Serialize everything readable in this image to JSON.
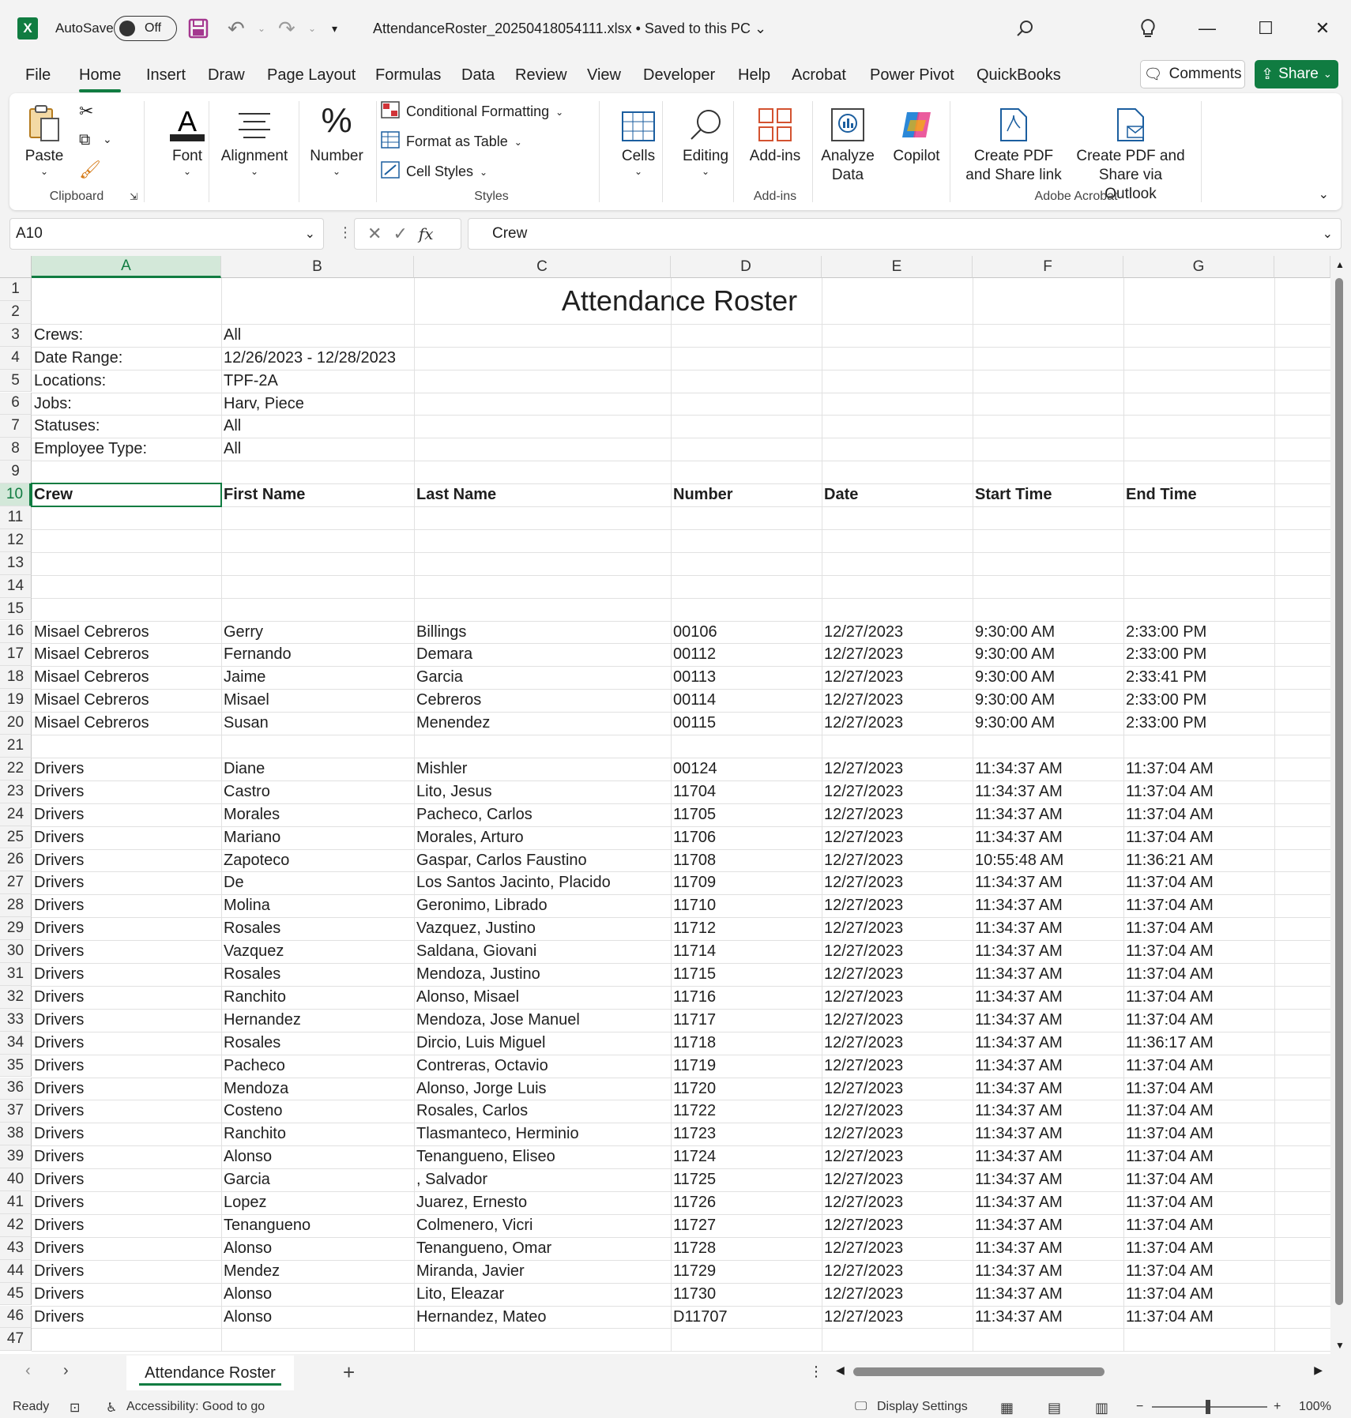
{
  "titlebar": {
    "autosave_label": "AutoSave",
    "autosave_state": "Off",
    "filename": "AttendanceRoster_20250418054111.xlsx • Saved to this PC"
  },
  "menu": [
    "File",
    "Home",
    "Insert",
    "Draw",
    "Page Layout",
    "Formulas",
    "Data",
    "Review",
    "View",
    "Developer",
    "Help",
    "Acrobat",
    "Power Pivot",
    "QuickBooks"
  ],
  "menu_active": "Home",
  "actions": {
    "comments": "Comments",
    "share": "Share"
  },
  "ribbon": {
    "paste": "Paste",
    "clipboard": "Clipboard",
    "font": "Font",
    "alignment": "Alignment",
    "number": "Number",
    "conditional_formatting": "Conditional Formatting",
    "format_as_table": "Format as Table",
    "cell_styles": "Cell Styles",
    "styles": "Styles",
    "cells": "Cells",
    "editing": "Editing",
    "addins": "Add-ins",
    "addins_group": "Add-ins",
    "analyze_data_1": "Analyze",
    "analyze_data_2": "Data",
    "copilot": "Copilot",
    "create_pdf_share_1": "Create PDF",
    "create_pdf_share_2": "and Share link",
    "create_pdf_outlook_1": "Create PDF and",
    "create_pdf_outlook_2": "Share via Outlook",
    "adobe_acrobat": "Adobe Acrobat"
  },
  "formula_bar": {
    "name_box": "A10",
    "value": "Crew"
  },
  "columns": [
    "A",
    "B",
    "C",
    "D",
    "E",
    "F",
    "G"
  ],
  "sheet": {
    "title": "Attendance Roster",
    "filters": [
      {
        "label": "Crews:",
        "value": "All"
      },
      {
        "label": "Date Range:",
        "value": "12/26/2023 - 12/28/2023"
      },
      {
        "label": "Locations:",
        "value": "TPF-2A"
      },
      {
        "label": "Jobs:",
        "value": "Harv, Piece"
      },
      {
        "label": "Statuses:",
        "value": "All"
      },
      {
        "label": "Employee Type:",
        "value": "All"
      }
    ],
    "headers": [
      "Crew",
      "First Name",
      "Last Name",
      "Number",
      "Date",
      "Start Time",
      "End Time"
    ],
    "rows": [
      {
        "r": 16,
        "v": [
          "Misael Cebreros",
          "Gerry",
          "Billings",
          "00106",
          "12/27/2023",
          "9:30:00 AM",
          "2:33:00 PM"
        ]
      },
      {
        "r": 17,
        "v": [
          "Misael Cebreros",
          "Fernando",
          "Demara",
          "00112",
          "12/27/2023",
          "9:30:00 AM",
          "2:33:00 PM"
        ]
      },
      {
        "r": 18,
        "v": [
          "Misael Cebreros",
          "Jaime",
          "Garcia",
          "00113",
          "12/27/2023",
          "9:30:00 AM",
          "2:33:41 PM"
        ]
      },
      {
        "r": 19,
        "v": [
          "Misael Cebreros",
          "Misael",
          "Cebreros",
          "00114",
          "12/27/2023",
          "9:30:00 AM",
          "2:33:00 PM"
        ]
      },
      {
        "r": 20,
        "v": [
          "Misael Cebreros",
          "Susan",
          "Menendez",
          "00115",
          "12/27/2023",
          "9:30:00 AM",
          "2:33:00 PM"
        ]
      },
      {
        "r": 22,
        "v": [
          "Drivers",
          "Diane",
          "Mishler",
          "00124",
          "12/27/2023",
          "11:34:37 AM",
          "11:37:04 AM"
        ]
      },
      {
        "r": 23,
        "v": [
          "Drivers",
          "Castro",
          "Lito, Jesus",
          "11704",
          "12/27/2023",
          "11:34:37 AM",
          "11:37:04 AM"
        ]
      },
      {
        "r": 24,
        "v": [
          "Drivers",
          "Morales",
          "Pacheco, Carlos",
          "11705",
          "12/27/2023",
          "11:34:37 AM",
          "11:37:04 AM"
        ]
      },
      {
        "r": 25,
        "v": [
          "Drivers",
          "Mariano",
          "Morales, Arturo",
          "11706",
          "12/27/2023",
          "11:34:37 AM",
          "11:37:04 AM"
        ]
      },
      {
        "r": 26,
        "v": [
          "Drivers",
          "Zapoteco",
          "Gaspar, Carlos Faustino",
          "11708",
          "12/27/2023",
          "10:55:48 AM",
          "11:36:21 AM"
        ]
      },
      {
        "r": 27,
        "v": [
          "Drivers",
          "De",
          "Los Santos Jacinto, Placido",
          "11709",
          "12/27/2023",
          "11:34:37 AM",
          "11:37:04 AM"
        ]
      },
      {
        "r": 28,
        "v": [
          "Drivers",
          "Molina",
          "Geronimo, Librado",
          "11710",
          "12/27/2023",
          "11:34:37 AM",
          "11:37:04 AM"
        ]
      },
      {
        "r": 29,
        "v": [
          "Drivers",
          "Rosales",
          "Vazquez, Justino",
          "11712",
          "12/27/2023",
          "11:34:37 AM",
          "11:37:04 AM"
        ]
      },
      {
        "r": 30,
        "v": [
          "Drivers",
          "Vazquez",
          "Saldana, Giovani",
          "11714",
          "12/27/2023",
          "11:34:37 AM",
          "11:37:04 AM"
        ]
      },
      {
        "r": 31,
        "v": [
          "Drivers",
          "Rosales",
          "Mendoza, Justino",
          "11715",
          "12/27/2023",
          "11:34:37 AM",
          "11:37:04 AM"
        ]
      },
      {
        "r": 32,
        "v": [
          "Drivers",
          "Ranchito",
          "Alonso, Misael",
          "11716",
          "12/27/2023",
          "11:34:37 AM",
          "11:37:04 AM"
        ]
      },
      {
        "r": 33,
        "v": [
          "Drivers",
          "Hernandez",
          "Mendoza, Jose Manuel",
          "11717",
          "12/27/2023",
          "11:34:37 AM",
          "11:37:04 AM"
        ]
      },
      {
        "r": 34,
        "v": [
          "Drivers",
          "Rosales",
          "Dircio, Luis Miguel",
          "11718",
          "12/27/2023",
          "11:34:37 AM",
          "11:36:17 AM"
        ]
      },
      {
        "r": 35,
        "v": [
          "Drivers",
          "Pacheco",
          "Contreras, Octavio",
          "11719",
          "12/27/2023",
          "11:34:37 AM",
          "11:37:04 AM"
        ]
      },
      {
        "r": 36,
        "v": [
          "Drivers",
          "Mendoza",
          "Alonso, Jorge Luis",
          "11720",
          "12/27/2023",
          "11:34:37 AM",
          "11:37:04 AM"
        ]
      },
      {
        "r": 37,
        "v": [
          "Drivers",
          "Costeno",
          "Rosales, Carlos",
          "11722",
          "12/27/2023",
          "11:34:37 AM",
          "11:37:04 AM"
        ]
      },
      {
        "r": 38,
        "v": [
          "Drivers",
          "Ranchito",
          "Tlasmanteco, Herminio",
          "11723",
          "12/27/2023",
          "11:34:37 AM",
          "11:37:04 AM"
        ]
      },
      {
        "r": 39,
        "v": [
          "Drivers",
          "Alonso",
          "Tenangueno, Eliseo",
          "11724",
          "12/27/2023",
          "11:34:37 AM",
          "11:37:04 AM"
        ]
      },
      {
        "r": 40,
        "v": [
          "Drivers",
          "Garcia",
          ", Salvador",
          "11725",
          "12/27/2023",
          "11:34:37 AM",
          "11:37:04 AM"
        ]
      },
      {
        "r": 41,
        "v": [
          "Drivers",
          "Lopez",
          "Juarez, Ernesto",
          "11726",
          "12/27/2023",
          "11:34:37 AM",
          "11:37:04 AM"
        ]
      },
      {
        "r": 42,
        "v": [
          "Drivers",
          "Tenangueno",
          "Colmenero, Vicri",
          "11727",
          "12/27/2023",
          "11:34:37 AM",
          "11:37:04 AM"
        ]
      },
      {
        "r": 43,
        "v": [
          "Drivers",
          "Alonso",
          "Tenangueno, Omar",
          "11728",
          "12/27/2023",
          "11:34:37 AM",
          "11:37:04 AM"
        ]
      },
      {
        "r": 44,
        "v": [
          "Drivers",
          "Mendez",
          "Miranda, Javier",
          "11729",
          "12/27/2023",
          "11:34:37 AM",
          "11:37:04 AM"
        ]
      },
      {
        "r": 45,
        "v": [
          "Drivers",
          "Alonso",
          "Lito, Eleazar",
          "11730",
          "12/27/2023",
          "11:34:37 AM",
          "11:37:04 AM"
        ]
      },
      {
        "r": 46,
        "v": [
          "Drivers",
          "Alonso",
          "Hernandez, Mateo",
          "D11707",
          "12/27/2023",
          "11:34:37 AM",
          "11:37:04 AM"
        ]
      }
    ]
  },
  "sheet_tab": "Attendance Roster",
  "status": {
    "ready": "Ready",
    "accessibility": "Accessibility: Good to go",
    "display_settings": "Display Settings",
    "zoom": "100%"
  },
  "colors": {
    "accent": "#107c41",
    "share_bg": "#107c41",
    "save_icon": "#a4378f"
  }
}
